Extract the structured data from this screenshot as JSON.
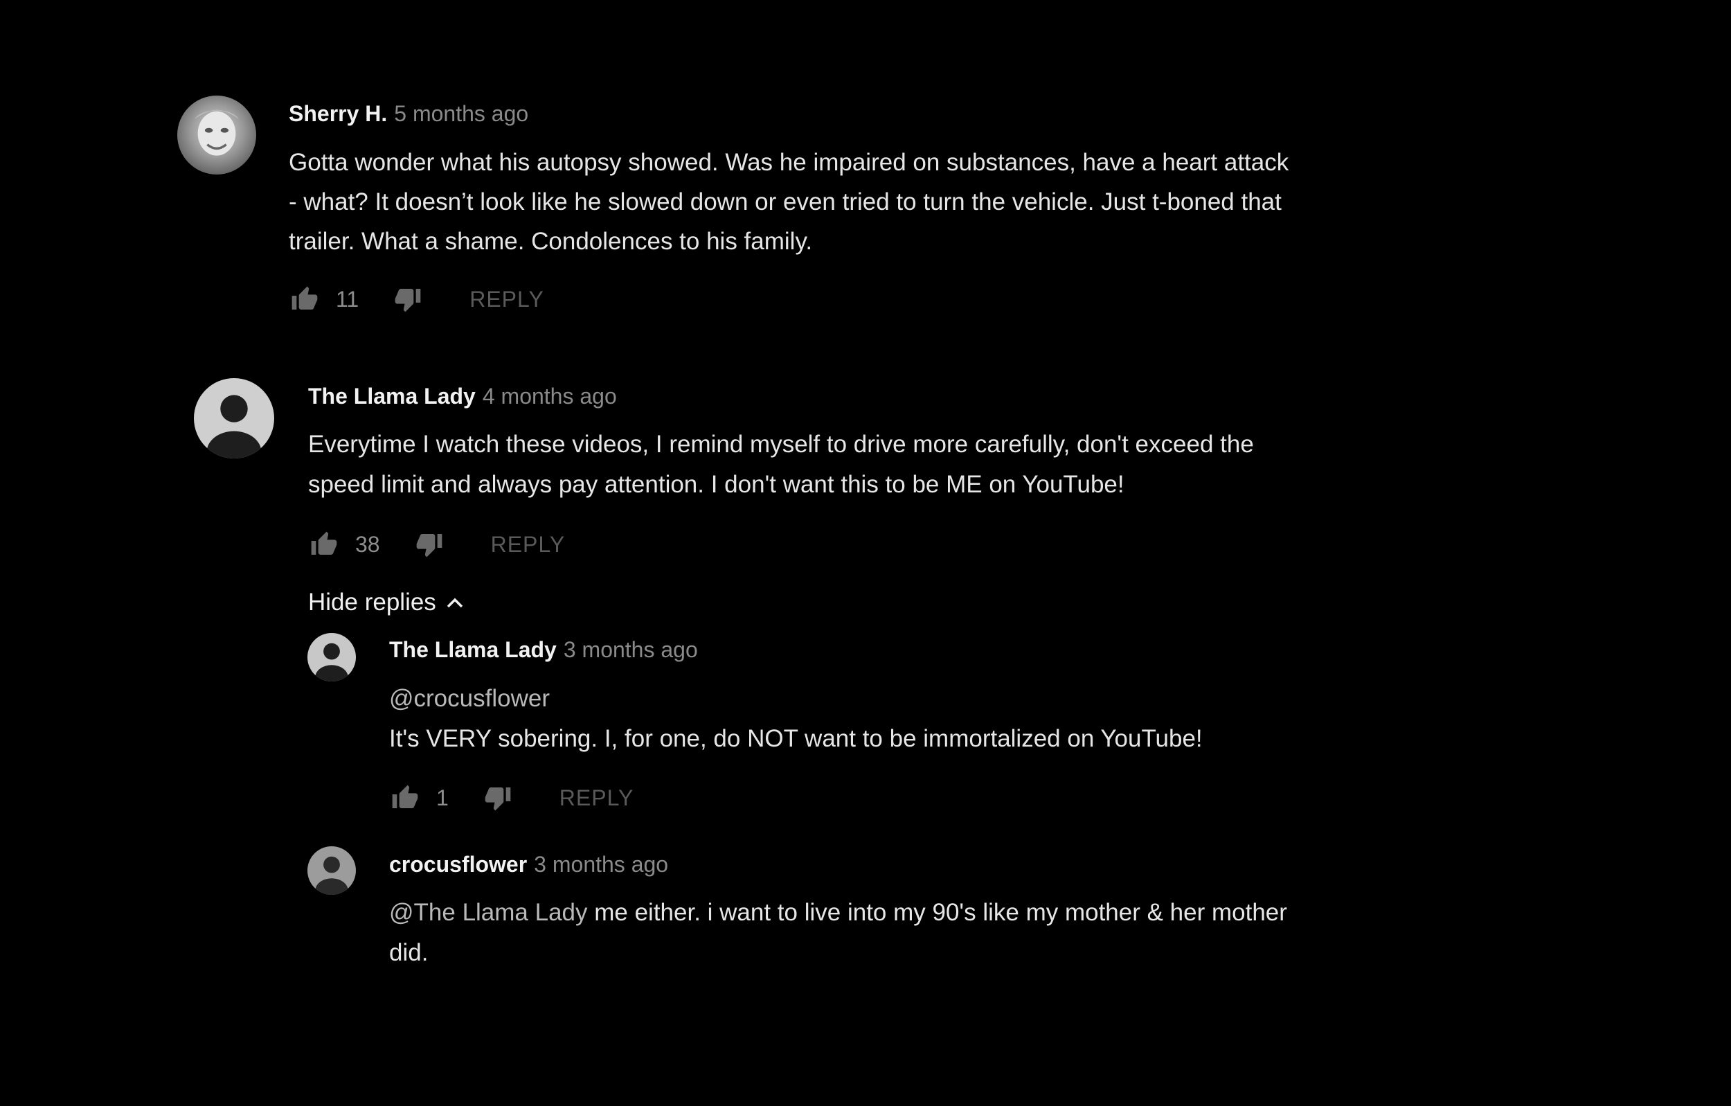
{
  "comments": [
    {
      "author": "Sherry H.",
      "time": "5 months ago",
      "lines": [
        "Gotta wonder what his autopsy showed. Was he impaired on substances, have a heart attack",
        "- what? It doesn’t look like he slowed down or even tried to turn the vehicle. Just t-boned that",
        "trailer. What a shame. Condolences to his family."
      ],
      "likes": "11",
      "reply_label": "REPLY",
      "avatar_icon": "photo-avatar-icon"
    },
    {
      "author": "The Llama Lady",
      "time": "4 months ago",
      "lines": [
        "Everytime I watch these videos, I remind myself to drive more carefully, don't exceed the",
        "speed limit and always pay attention. I don't want this to be ME on YouTube!"
      ],
      "likes": "38",
      "reply_label": "REPLY",
      "avatar_icon": "default-avatar-icon",
      "hide_replies_label": "Hide replies",
      "replies": [
        {
          "author": "The Llama Lady",
          "time": "3 months ago",
          "mention": "@crocusflower",
          "lines": [
            "It's VERY sobering. I, for one, do NOT want to be immortalized on YouTube!"
          ],
          "likes": "1",
          "reply_label": "REPLY"
        },
        {
          "author": "crocusflower",
          "time": "3 months ago",
          "mention": "@The Llama Lady",
          "lines": [
            " me either. i want to live into my 90's like my mother & her mother",
            "did."
          ]
        }
      ]
    }
  ],
  "colors": {
    "background": "#000000",
    "author": "#f2f2f2",
    "timestamp": "#8a8a8a",
    "body": "#e6e6e6",
    "reply_button": "#5a5a5a"
  },
  "icons": [
    "thumbs-up-icon",
    "thumbs-down-icon",
    "chevron-up-icon"
  ]
}
